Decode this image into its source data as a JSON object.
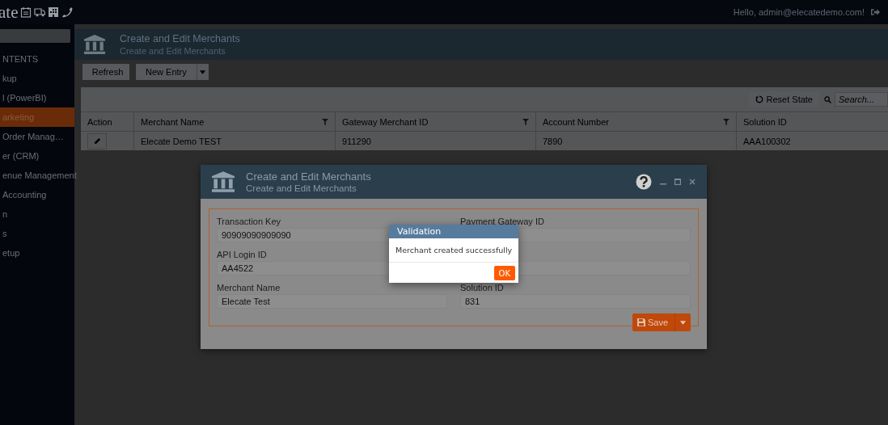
{
  "topbar": {
    "logo_text": "ate",
    "greeting": "Hello, admin@elecatedemo.com!"
  },
  "sidebar": {
    "heading": "NTENTS",
    "items": [
      {
        "label": "kup",
        "selected": false
      },
      {
        "label": "l (PowerBI)",
        "selected": false
      },
      {
        "label": "arketing",
        "selected": true
      },
      {
        "label": "Order Manag…",
        "selected": false
      },
      {
        "label": "er (CRM)",
        "selected": false
      },
      {
        "label": "enue Management",
        "selected": false
      },
      {
        "label": "Accounting",
        "selected": false
      },
      {
        "label": "n",
        "selected": false
      },
      {
        "label": "s",
        "selected": false
      },
      {
        "label": "etup",
        "selected": false
      }
    ]
  },
  "page_header": {
    "title": "Create and Edit Merchants",
    "subtitle": "Create and Edit Merchants"
  },
  "toolbar": {
    "refresh": "Refresh",
    "new_entry": "New Entry"
  },
  "grid": {
    "reset": "Reset State",
    "search_placeholder": "Search...",
    "columns": [
      {
        "label": "Action",
        "filter": false
      },
      {
        "label": "Merchant Name",
        "filter": true
      },
      {
        "label": "Gateway Merchant ID",
        "filter": true
      },
      {
        "label": "Account Number",
        "filter": true
      },
      {
        "label": "Solution ID",
        "filter": false
      }
    ],
    "rows": [
      {
        "cells": [
          "",
          "Elecate Demo TEST",
          "911290",
          "7890",
          "AAA100302"
        ]
      }
    ]
  },
  "modal": {
    "title": "Create and Edit Merchants",
    "subtitle": "Create and Edit Merchants",
    "save": "Save",
    "fields": [
      {
        "kind": "input",
        "label": "Transaction Key",
        "value": "90909090909090"
      },
      {
        "kind": "input",
        "label": "Payment Gateway ID"
      },
      {
        "kind": "input",
        "label": "API Login ID",
        "value": "AA4522"
      },
      {
        "kind": "input"
      },
      {
        "kind": "input",
        "label": "Merchant Name",
        "value": "Elecate Test"
      },
      {
        "kind": "input",
        "label": "Solution ID",
        "value": "831"
      }
    ]
  },
  "dialog": {
    "title": "Validation",
    "message": "Merchant created successfully",
    "ok": "OK"
  }
}
